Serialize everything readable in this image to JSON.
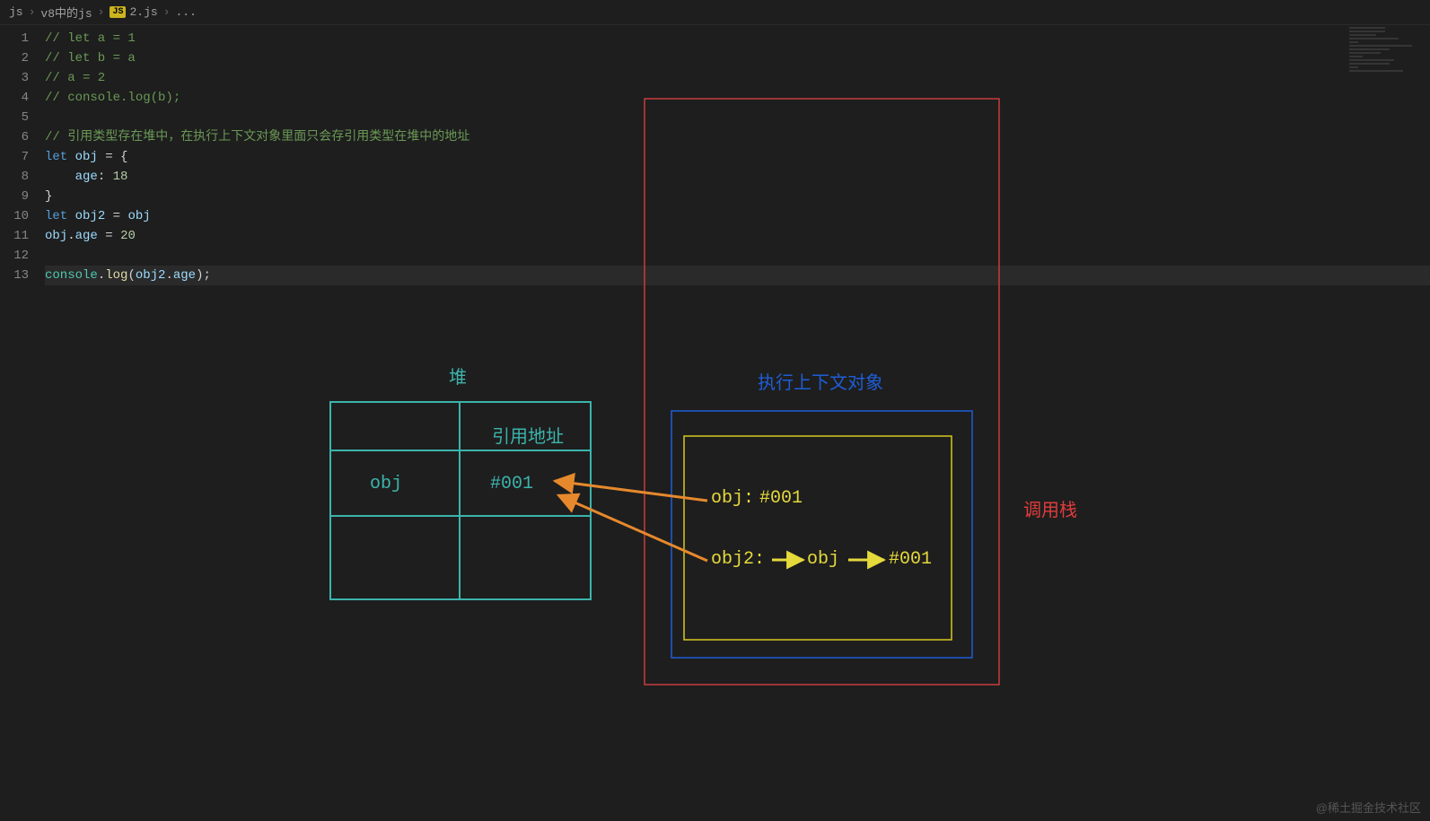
{
  "breadcrumb": {
    "items": [
      "js",
      "v8中的js",
      "2.js",
      "..."
    ],
    "fileIcon": "JS"
  },
  "code": {
    "lines": [
      {
        "num": "1",
        "tokens": [
          {
            "c": "tok-comment",
            "t": "// let a = 1"
          }
        ]
      },
      {
        "num": "2",
        "tokens": [
          {
            "c": "tok-comment",
            "t": "// let b = a"
          }
        ]
      },
      {
        "num": "3",
        "tokens": [
          {
            "c": "tok-comment",
            "t": "// a = 2"
          }
        ]
      },
      {
        "num": "4",
        "tokens": [
          {
            "c": "tok-comment",
            "t": "// console.log(b);"
          }
        ]
      },
      {
        "num": "5",
        "tokens": []
      },
      {
        "num": "6",
        "tokens": [
          {
            "c": "tok-comment",
            "t": "// 引用类型存在堆中，在执行上下文对象里面只会存引用类型在堆中的地址"
          }
        ]
      },
      {
        "num": "7",
        "tokens": [
          {
            "c": "tok-keyword",
            "t": "let "
          },
          {
            "c": "tok-var",
            "t": "obj"
          },
          {
            "c": "tok-punct",
            "t": " = {"
          }
        ]
      },
      {
        "num": "8",
        "tokens": [
          {
            "c": "tok-punct",
            "t": "    "
          },
          {
            "c": "tok-prop",
            "t": "age"
          },
          {
            "c": "tok-punct",
            "t": ": "
          },
          {
            "c": "tok-num",
            "t": "18"
          }
        ]
      },
      {
        "num": "9",
        "tokens": [
          {
            "c": "tok-punct",
            "t": "}"
          }
        ]
      },
      {
        "num": "10",
        "tokens": [
          {
            "c": "tok-keyword",
            "t": "let "
          },
          {
            "c": "tok-var",
            "t": "obj2"
          },
          {
            "c": "tok-punct",
            "t": " = "
          },
          {
            "c": "tok-var",
            "t": "obj"
          }
        ]
      },
      {
        "num": "11",
        "tokens": [
          {
            "c": "tok-var",
            "t": "obj"
          },
          {
            "c": "tok-punct",
            "t": "."
          },
          {
            "c": "tok-prop",
            "t": "age"
          },
          {
            "c": "tok-punct",
            "t": " = "
          },
          {
            "c": "tok-num",
            "t": "20"
          }
        ]
      },
      {
        "num": "12",
        "tokens": []
      },
      {
        "num": "13",
        "tokens": [
          {
            "c": "tok-obj",
            "t": "console"
          },
          {
            "c": "tok-punct",
            "t": "."
          },
          {
            "c": "tok-fn",
            "t": "log"
          },
          {
            "c": "tok-punct",
            "t": "("
          },
          {
            "c": "tok-var",
            "t": "obj2"
          },
          {
            "c": "tok-punct",
            "t": "."
          },
          {
            "c": "tok-prop",
            "t": "age"
          },
          {
            "c": "tok-punct",
            "t": ");"
          }
        ],
        "hl": true
      }
    ]
  },
  "diagram": {
    "heapLabel": "堆",
    "refAddrHeader": "引用地址",
    "heapObjName": "obj",
    "heapObjAddr": "#001",
    "contextLabel": "执行上下文对象",
    "stackLabel": "调用栈",
    "ctxObjKey": "obj:",
    "ctxObjVal": "#001",
    "ctxObj2Key": "obj2:",
    "ctxObj2Mid": "obj",
    "ctxObj2Val": "#001"
  },
  "watermark": "@稀土掘金技术社区"
}
